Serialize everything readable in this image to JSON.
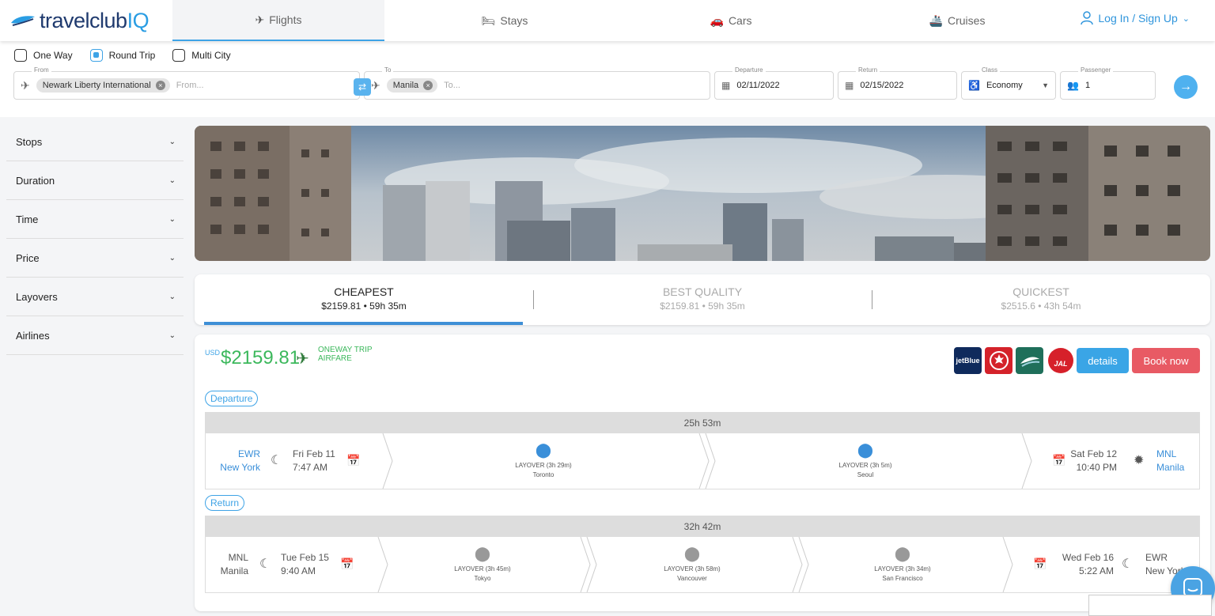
{
  "brand": {
    "name_main": "travelclub",
    "name_suffix": "IQ"
  },
  "nav": {
    "tabs": [
      {
        "label": "Flights",
        "icon": "plane-icon"
      },
      {
        "label": "Stays",
        "icon": "bed-icon"
      },
      {
        "label": "Cars",
        "icon": "car-icon"
      },
      {
        "label": "Cruises",
        "icon": "ship-icon"
      }
    ],
    "active_tab": "Flights",
    "login_label": "Log In / Sign Up"
  },
  "search": {
    "trip_types": [
      {
        "label": "One Way",
        "checked": false
      },
      {
        "label": "Round Trip",
        "checked": true
      },
      {
        "label": "Multi City",
        "checked": false
      }
    ],
    "from": {
      "label": "From",
      "value": "Newark Liberty International",
      "placeholder": "From..."
    },
    "to": {
      "label": "To",
      "value": "Manila",
      "placeholder": "To..."
    },
    "departure": {
      "label": "Departure",
      "value": "02/11/2022"
    },
    "return": {
      "label": "Return",
      "value": "02/15/2022"
    },
    "class": {
      "label": "Class",
      "value": "Economy"
    },
    "passenger": {
      "label": "Passenger",
      "value": "1"
    }
  },
  "filters": [
    "Stops",
    "Duration",
    "Time",
    "Price",
    "Layovers",
    "Airlines"
  ],
  "sort": [
    {
      "title": "CHEAPEST",
      "sub": "$2159.81 • 59h 35m",
      "active": true
    },
    {
      "title": "BEST QUALITY",
      "sub": "$2159.81 • 59h 35m",
      "active": false
    },
    {
      "title": "QUICKEST",
      "sub": "$2515.6 • 43h 54m",
      "active": false
    }
  ],
  "result": {
    "currency": "USD",
    "price": "$2159.81",
    "trip_type_line1": "ONEWAY TRIP",
    "trip_type_line2": "AIRFARE",
    "airlines": [
      {
        "name": "jetBlue",
        "color": "#0f2a5c"
      },
      {
        "name": "Air Canada",
        "color": "#d4222a"
      },
      {
        "name": "Philippine Airlines",
        "color": "#1f6f5a"
      },
      {
        "name": "JAL",
        "color": "#ffffff"
      }
    ],
    "details_label": "details",
    "book_label": "Book now",
    "departure": {
      "tag": "Departure",
      "duration": "25h 53m",
      "origin_code": "EWR",
      "origin_city": "New York",
      "depart_date": "Fri Feb 11",
      "depart_time": "7:47 AM",
      "layovers": [
        {
          "text": "LAYOVER (3h 29m)",
          "city": "Toronto"
        },
        {
          "text": "LAYOVER (3h 5m)",
          "city": "Seoul"
        }
      ],
      "arrive_date": "Sat Feb 12",
      "arrive_time": "10:40 PM",
      "dest_code": "MNL",
      "dest_city": "Manila"
    },
    "return": {
      "tag": "Return",
      "duration": "32h 42m",
      "origin_code": "MNL",
      "origin_city": "Manila",
      "depart_date": "Tue Feb 15",
      "depart_time": "9:40 AM",
      "layovers": [
        {
          "text": "LAYOVER (3h 45m)",
          "city": "Tokyo"
        },
        {
          "text": "LAYOVER (3h 58m)",
          "city": "Vancouver"
        },
        {
          "text": "LAYOVER (3h 34m)",
          "city": "San Francisco"
        }
      ],
      "arrive_date": "Wed Feb 16",
      "arrive_time": "5:22 AM",
      "dest_code": "EWR",
      "dest_city": "New York"
    }
  },
  "colors": {
    "accent": "#3ea3e6",
    "price": "#3cb85c",
    "book": "#e85a64"
  }
}
